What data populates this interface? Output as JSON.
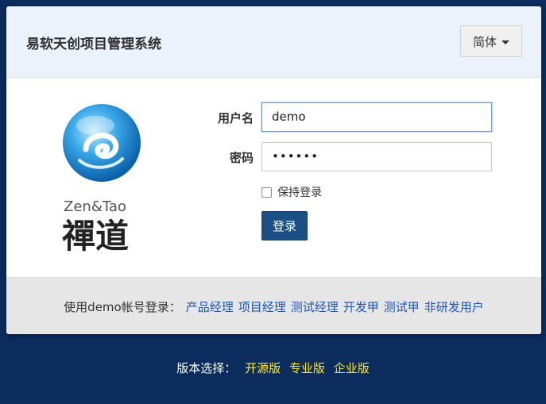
{
  "header": {
    "title": "易软天创项目管理系统",
    "language_button": "简体"
  },
  "logo": {
    "brand_text": "Zen&Tao",
    "brand_cn": "禪道"
  },
  "form": {
    "username_label": "用户名",
    "username_value": "demo",
    "password_label": "密码",
    "password_value": "••••••",
    "remember_label": "保持登录",
    "remember_checked": false,
    "login_button": "登录"
  },
  "demo_accounts": {
    "prompt": "使用demo帐号登录：",
    "links": [
      "产品经理",
      "项目经理",
      "测试经理",
      "开发甲",
      "测试甲",
      "非研发用户"
    ]
  },
  "versions": {
    "prompt": "版本选择：",
    "links": [
      "开源版",
      "专业版",
      "企业版"
    ]
  },
  "colors": {
    "page_background": "#0b2c5c",
    "header_background": "#ebf2fb",
    "login_button": "#1c4f86",
    "focus_border": "#5b9ee8",
    "demo_link": "#1f55b5",
    "version_link": "#ffe71f"
  }
}
